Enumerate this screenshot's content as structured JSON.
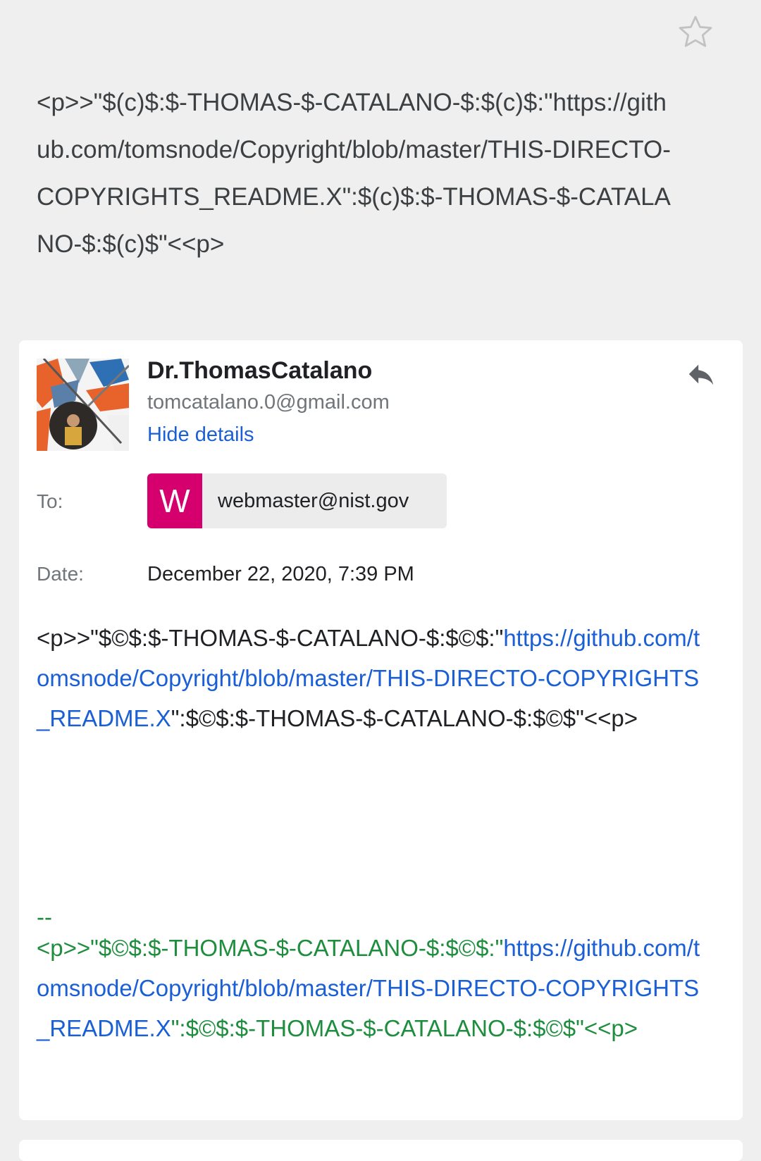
{
  "header": {
    "star_icon": "star-outline-icon",
    "subject": "<p>>\"$(c)$:$-THOMAS-$-CATALANO-$:$(c)$:\"https://github.com/tomsnode/Copyright/blob/master/THIS-DIRECTO-COPYRIGHTS_README.X\":$(c)$:$-THOMAS-$-CATALANO-$:$(c)$\"<<p>"
  },
  "message": {
    "sender_name": "Dr.ThomasCatalano",
    "sender_email": "tomcatalano.0@gmail.com",
    "hide_details_label": "Hide details",
    "reply_icon": "reply-icon",
    "to_label": "To:",
    "recipient_initial": "W",
    "recipient_email": "webmaster@nist.gov",
    "date_label": "Date:",
    "date_value": "December 22, 2020, 7:39 PM",
    "body_prefix": "<p>>\"$©$:$-THOMAS-$-CATALANO-$:$©$:\"",
    "body_link": "https://github.com/tomsnode/Copyright/blob/master/THIS-DIRECTO-COPYRIGHTS_README.X",
    "body_suffix": "\":$©$:$-THOMAS-$-CATALANO-$:$©$\"<<p>",
    "signature_dash": "--",
    "signature_prefix": "<p>>\"$©$:$-THOMAS-$-CATALANO-$:$©$:\"",
    "signature_link": "https://github.com/tomsnode/Copyright/blob/master/THIS-DIRECTO-COPYRIGHTS_README.X",
    "signature_suffix": "\":$©$:$-THOMAS-$-CATALANO-$:$©$\"<<p>"
  },
  "colors": {
    "background": "#efefef",
    "link": "#1a5fd6",
    "signature": "#1e8e3e",
    "recipient_avatar": "#d5006d"
  }
}
